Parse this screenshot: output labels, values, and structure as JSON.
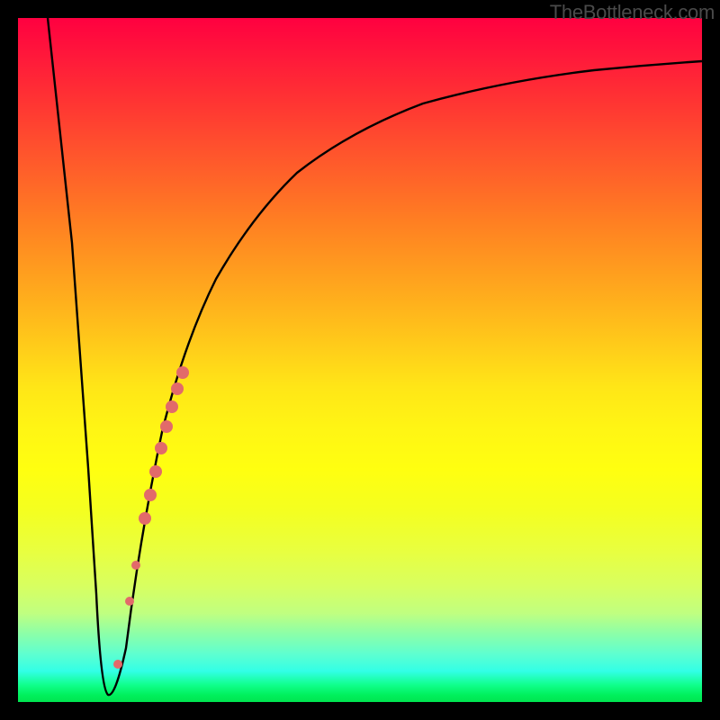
{
  "watermark": "TheBottleneck.com",
  "chart_data": {
    "type": "line",
    "title": "",
    "xlabel": "",
    "ylabel": "",
    "xlim": [
      0,
      100
    ],
    "ylim": [
      0,
      100
    ],
    "gradient_stops": [
      {
        "pos": 0,
        "color": "#ff0040"
      },
      {
        "pos": 50,
        "color": "#ffd018"
      },
      {
        "pos": 80,
        "color": "#f0ff40"
      },
      {
        "pos": 100,
        "color": "#00e450"
      }
    ],
    "series": [
      {
        "name": "bottleneck-curve",
        "color": "#000000",
        "x": [
          4,
          6,
          8,
          10,
          11,
          12,
          13,
          14,
          15,
          17,
          20,
          24,
          28,
          33,
          38,
          44,
          52,
          62,
          74,
          88,
          100
        ],
        "y": [
          100,
          65,
          32,
          6,
          0,
          1,
          4,
          10,
          18,
          32,
          46,
          57,
          65,
          71,
          76,
          80,
          83,
          86,
          88.5,
          90,
          91
        ]
      }
    ],
    "markers": {
      "name": "highlight-dots",
      "color": "#e26a6a",
      "points": [
        {
          "x": 13.0,
          "y": 6
        },
        {
          "x": 15.5,
          "y": 20
        },
        {
          "x": 16.5,
          "y": 27
        },
        {
          "x": 18.0,
          "y": 35
        },
        {
          "x": 18.8,
          "y": 39
        },
        {
          "x": 19.6,
          "y": 43
        },
        {
          "x": 20.4,
          "y": 47
        },
        {
          "x": 21.2,
          "y": 50
        },
        {
          "x": 22.0,
          "y": 53
        },
        {
          "x": 22.8,
          "y": 56
        },
        {
          "x": 23.6,
          "y": 58
        }
      ]
    }
  }
}
